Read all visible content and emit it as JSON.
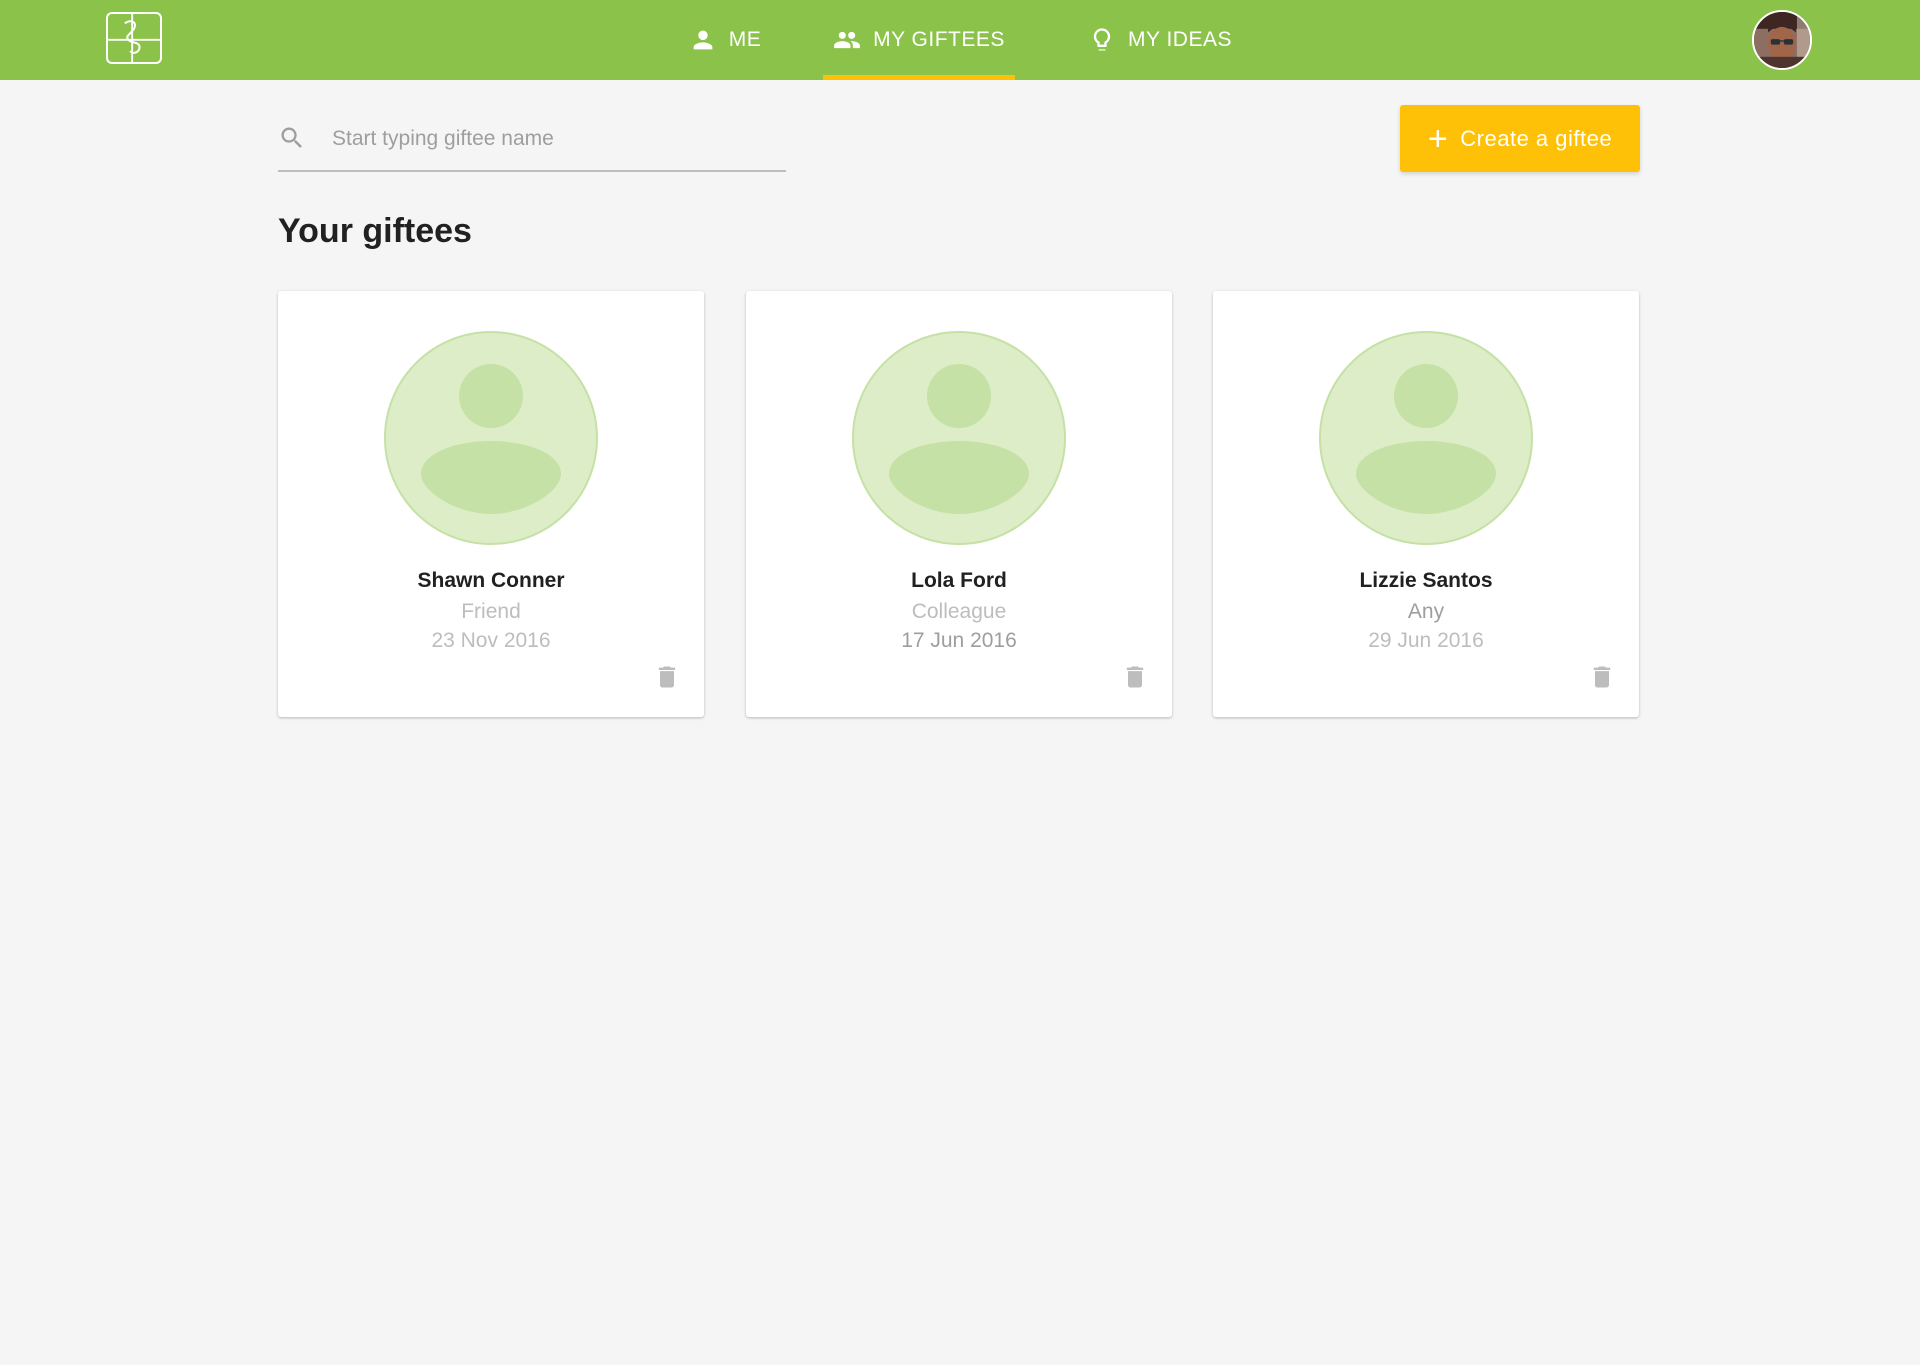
{
  "nav": {
    "tabs": [
      {
        "label": "ME",
        "icon": "person-icon"
      },
      {
        "label": "MY GIFTEES",
        "icon": "people-icon",
        "active": true
      },
      {
        "label": "MY IDEAS",
        "icon": "lightbulb-icon"
      }
    ]
  },
  "search": {
    "placeholder": "Start typing giftee name",
    "value": ""
  },
  "toolbar": {
    "create_label": "Create a giftee"
  },
  "page": {
    "title": "Your giftees"
  },
  "giftees": [
    {
      "name": "Shawn Conner",
      "relation": "Friend",
      "date": "23 Nov 2016"
    },
    {
      "name": "Lola Ford",
      "relation": "Colleague",
      "date": "17 Jun 2016"
    },
    {
      "name": "Lizzie Santos",
      "relation": "Any",
      "date": "29 Jun 2016"
    }
  ],
  "colors": {
    "header": "#8bc34a",
    "accent": "#ffc107",
    "avatar_bg": "#dcedc8",
    "avatar_fg": "#c5e1a5"
  }
}
